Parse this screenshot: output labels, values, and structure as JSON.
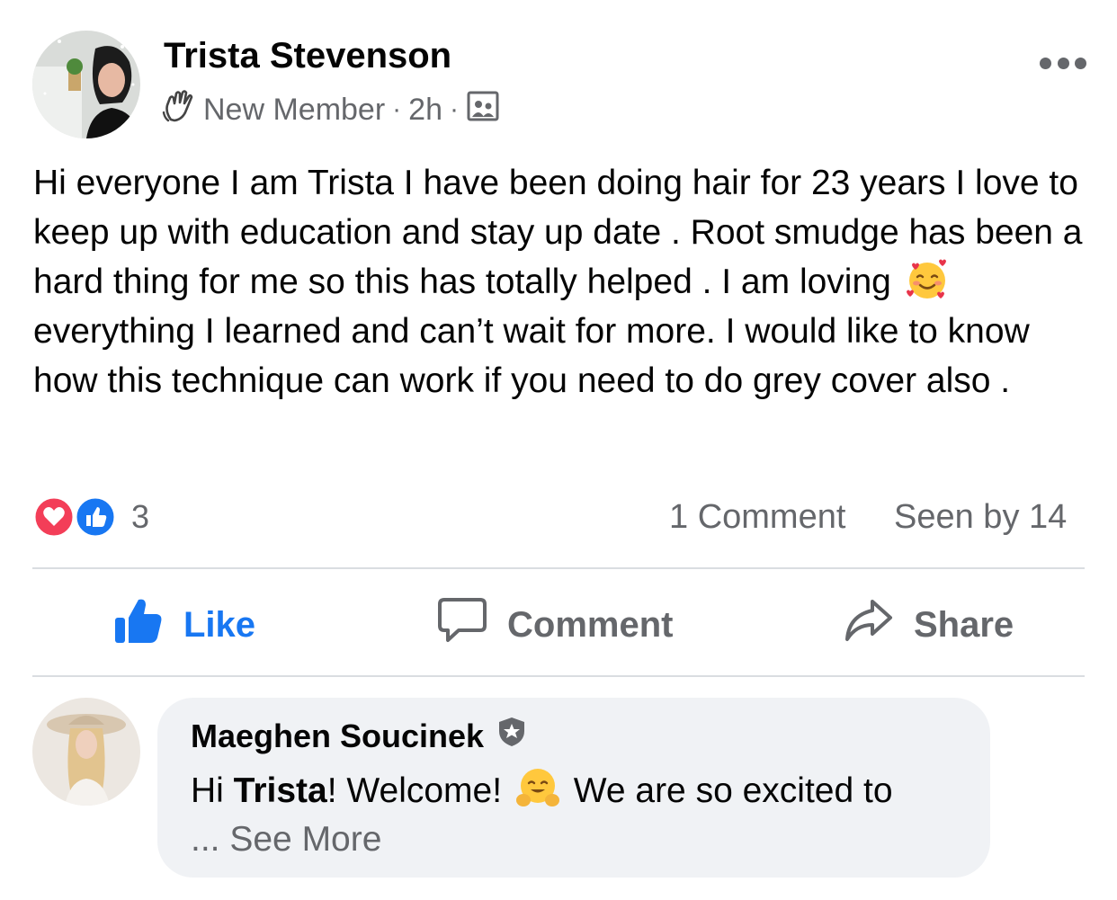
{
  "post": {
    "author": "Trista Stevenson",
    "badge": "New Member",
    "time": "2h",
    "separator": "·",
    "text_part1": "Hi everyone I am Trista I have been doing hair for 23 years I love to keep up with education and stay up date . Root smudge has been a hard thing for me so this has totally helped . I am loving",
    "text_emoji": "smiling-face-with-hearts",
    "text_part2": "everything I learned and can’t wait for more. I would like to know how this technique can work if you need to do grey cover also ."
  },
  "stats": {
    "reaction_count": "3",
    "reaction_types": [
      "love",
      "like"
    ],
    "comments": "1 Comment",
    "seen_by": "Seen by 14"
  },
  "actions": {
    "like": "Like",
    "comment": "Comment",
    "share": "Share"
  },
  "comment": {
    "author": "Maeghen Soucinek",
    "greeting": "Hi ",
    "name_mention": "Trista",
    "text_after_mention": "! Welcome! ",
    "emoji": "hugging-face",
    "text_rest": " We are so excited to",
    "ellipsis": "... ",
    "see_more": "See More"
  },
  "colors": {
    "accent": "#1877f2",
    "secondary_text": "#65676b",
    "love": "#f33e58",
    "bubble": "#f0f2f5"
  }
}
